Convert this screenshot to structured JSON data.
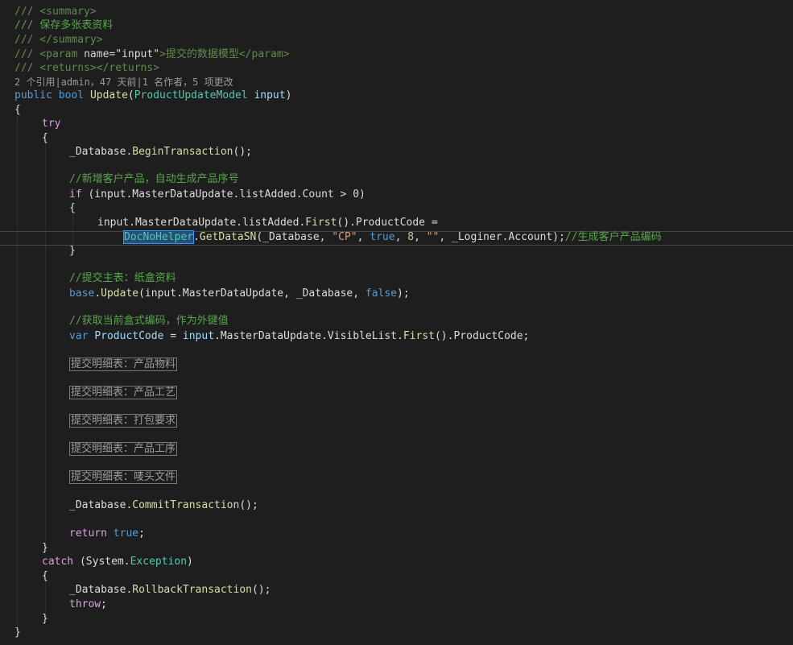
{
  "code": {
    "doc_summary_open": "/// <summary>",
    "doc_summary_text": "/// 保存多张表资料",
    "doc_summary_close": "/// </summary>",
    "doc_param_prefix": "/// <param ",
    "doc_param_attr": "name=",
    "doc_param_value": "\"input\"",
    "doc_param_rest": ">提交的数据模型</param>",
    "doc_returns": "/// <returns></returns>",
    "codelens": "2 个引用|admin，47 天前|1 名作者，5 项更改",
    "sig_public": "public",
    "sig_bool": "bool",
    "sig_method": "Update",
    "sig_open": "(",
    "sig_type": "ProductUpdateModel",
    "sig_param": "input",
    "sig_close": ")",
    "brace_open": "{",
    "brace_close": "}",
    "kw_try": "try",
    "db_ident": "_Database",
    "begin_tx": "BeginTransaction",
    "call_end": "();",
    "comment_add": "//新增客户产品，自动生成产品序号",
    "kw_if": "if",
    "if_cond": " (input.MasterDataUpdate.listAdded.Count > 0)",
    "assign_lhs_a": "input.MasterDataUpdate.listAdded.",
    "first": "First",
    "assign_lhs_b": "().ProductCode =",
    "docno_helper": "DocNoHelper",
    "getdatasn": "GetDataSN",
    "getdatasn_args_a": "(_Database, ",
    "str_cp": "\"CP\"",
    "comma": ", ",
    "kw_true": "true",
    "num_8": "8",
    "str_empty": "\"\"",
    "loginer": ", _Loginer.Account);",
    "comment_sn": "//生成客户产品编码",
    "comment_main": "//提交主表：纸盒资料",
    "kw_base": "base",
    "update_call": "Update",
    "update_args": "(input.MasterDataUpdate, _Database, ",
    "kw_false": "false",
    "close_semi": ");",
    "comment_fk": "//获取当前盒式编码，作为外键值",
    "kw_var": "var",
    "var_name": "ProductCode",
    "var_assign": " = ",
    "var_rhs_a": "input",
    "var_rhs_b": ".MasterDataUpdate.VisibleList.",
    "var_rhs_c": "().ProductCode;",
    "region_1": "提交明细表：产品物料",
    "region_2": "提交明细表：产品工艺",
    "region_3": "提交明细表：打包要求",
    "region_4": "提交明细表：产品工序",
    "region_5": "提交明细表：唛头文件",
    "commit_tx": "CommitTransaction",
    "kw_return": "return",
    "return_true": "true",
    "semi": ";",
    "kw_catch": "catch",
    "catch_open": " (System.",
    "exception": "Exception",
    "catch_close": ")",
    "rollback_tx": "RollbackTransaction",
    "kw_throw": "throw",
    "throw_semi": ";",
    "dot": ".",
    "space": " "
  }
}
